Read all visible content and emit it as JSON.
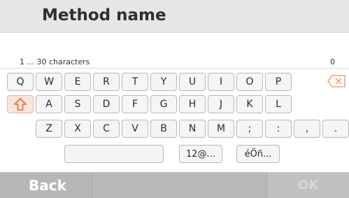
{
  "header": {
    "title": "Method name"
  },
  "input": {
    "hint": "1 ... 30 characters",
    "count": "0"
  },
  "keyboard": {
    "row1": [
      "Q",
      "W",
      "E",
      "R",
      "T",
      "Y",
      "U",
      "I",
      "O",
      "P"
    ],
    "row2": [
      "A",
      "S",
      "D",
      "F",
      "G",
      "H",
      "J",
      "K",
      "L"
    ],
    "row3": [
      "Z",
      "X",
      "C",
      "V",
      "B",
      "N",
      "M",
      ";",
      ":",
      ",",
      "."
    ],
    "row4": {
      "space": "",
      "numbers": "12@...",
      "accents": "éÖñ..."
    },
    "icons": {
      "shift": "shift-arrow-icon",
      "backspace": "backspace-icon"
    }
  },
  "footer": {
    "back_label": "Back",
    "ok_label": "OK"
  },
  "colors": {
    "header_bg": "#e6e6e6",
    "footer_bg": "#b7b7b7",
    "shift_orange": "#ef7f45",
    "disabled_text": "#d7d7d7"
  }
}
